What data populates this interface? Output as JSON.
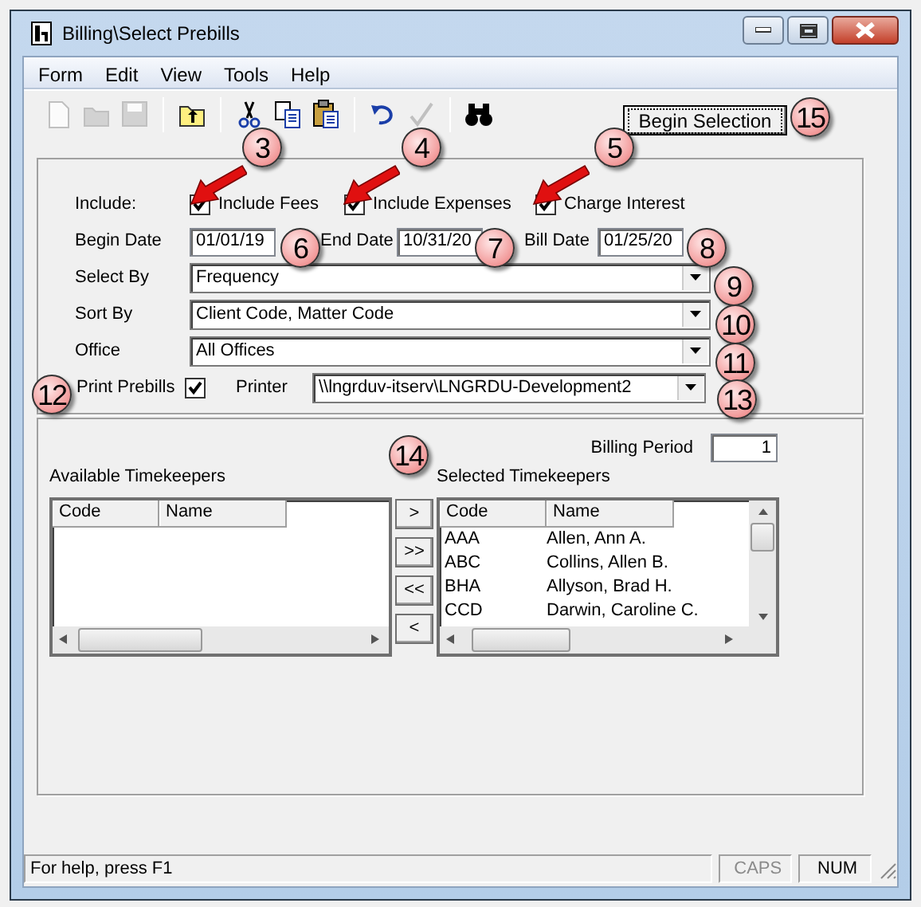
{
  "window": {
    "title": "Billing\\Select Prebills"
  },
  "menu": [
    "Form",
    "Edit",
    "View",
    "Tools",
    "Help"
  ],
  "toolbar": [
    {
      "kind": "new",
      "disabled": true
    },
    {
      "kind": "open",
      "disabled": true
    },
    {
      "kind": "save",
      "disabled": true
    },
    {
      "kind": "sep"
    },
    {
      "kind": "up",
      "disabled": false
    },
    {
      "kind": "sep"
    },
    {
      "kind": "cut",
      "disabled": false
    },
    {
      "kind": "copy",
      "disabled": false
    },
    {
      "kind": "paste",
      "disabled": false
    },
    {
      "kind": "sep"
    },
    {
      "kind": "undo",
      "disabled": false
    },
    {
      "kind": "spell",
      "disabled": true
    },
    {
      "kind": "sep"
    },
    {
      "kind": "find",
      "disabled": false
    }
  ],
  "begin_selection_button": "Begin Selection",
  "include": {
    "label": "Include:",
    "options": [
      {
        "label": "Include Fees",
        "checked": true
      },
      {
        "label": "Include Expenses",
        "checked": true
      },
      {
        "label": "Charge Interest",
        "checked": true
      }
    ]
  },
  "dates": [
    {
      "label": "Begin Date",
      "value": "01/01/19"
    },
    {
      "label": "End Date",
      "value": "10/31/20"
    },
    {
      "label": "Bill Date",
      "value": "01/25/20"
    }
  ],
  "combos": [
    {
      "label": "Select By",
      "value": "Frequency"
    },
    {
      "label": "Sort By",
      "value": "Client Code, Matter Code"
    },
    {
      "label": "Office",
      "value": "All Offices"
    }
  ],
  "print_prebills": {
    "label": "Print Prebills",
    "checked": true,
    "printer_label": "Printer",
    "printer": "\\\\lngrduv-itserv\\LNGRDU-Development2"
  },
  "billing_period": {
    "label": "Billing Period",
    "value": "1"
  },
  "available_timekeepers": {
    "label": "Available Timekeepers",
    "columns": [
      "Code",
      "Name"
    ]
  },
  "transfer_buttons": [
    ">",
    ">>",
    "<<",
    "<"
  ],
  "selected_timekeepers": {
    "label": "Selected Timekeepers",
    "columns": [
      "Code",
      "Name"
    ],
    "rows": [
      {
        "code": "AAA",
        "name": "Allen, Ann A."
      },
      {
        "code": "ABC",
        "name": "Collins, Allen B."
      },
      {
        "code": "BHA",
        "name": "Allyson, Brad H."
      },
      {
        "code": "CCD",
        "name": "Darwin, Caroline C."
      }
    ]
  },
  "status_bar": {
    "text": "For help, press F1",
    "panels": [
      {
        "label": "CAPS",
        "disabled": true
      },
      {
        "label": "NUM",
        "disabled": false
      }
    ]
  },
  "callouts": [
    {
      "number": "3",
      "arrow": true
    },
    {
      "number": "4",
      "arrow": true
    },
    {
      "number": "5",
      "arrow": true
    },
    {
      "number": "6",
      "arrow": false
    },
    {
      "number": "7",
      "arrow": false
    },
    {
      "number": "8",
      "arrow": false
    },
    {
      "number": "9",
      "arrow": false
    },
    {
      "number": "10",
      "arrow": false
    },
    {
      "number": "11",
      "arrow": false
    },
    {
      "number": "12",
      "arrow": false
    },
    {
      "number": "13",
      "arrow": false
    },
    {
      "number": "14",
      "arrow": false
    },
    {
      "number": "15",
      "arrow": false
    }
  ]
}
